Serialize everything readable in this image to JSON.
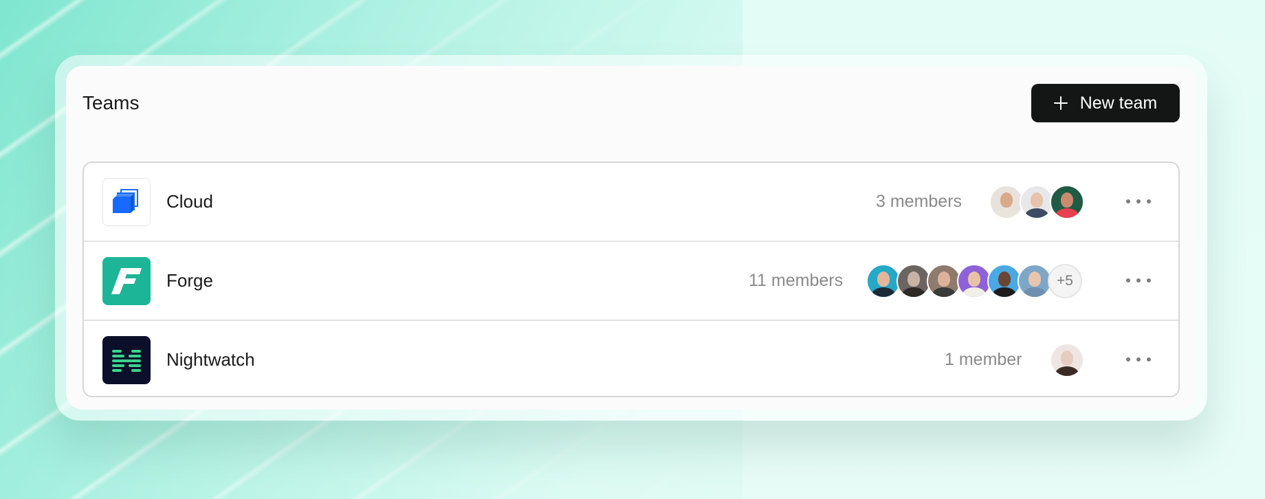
{
  "header": {
    "title": "Teams",
    "new_team_label": "New team"
  },
  "teams": [
    {
      "name": "Cloud",
      "members_label": "3 members",
      "logo": "cloud-logo-icon",
      "avatars": [
        {
          "skin": "#d9a98a",
          "shirt": "#e9e4dc",
          "bg": "#e7e2dc"
        },
        {
          "skin": "#e6c3ad",
          "shirt": "#3d4b63",
          "bg": "#e8e8ea"
        },
        {
          "skin": "#c98b6e",
          "shirt": "#e8404f",
          "bg": "#1f5b45"
        }
      ]
    },
    {
      "name": "Forge",
      "members_label": "11 members",
      "logo": "forge-logo-icon",
      "avatars": [
        {
          "skin": "#e2b79b",
          "shirt": "#1c2a36",
          "bg": "#25a9c6"
        },
        {
          "skin": "#c9b3a4",
          "shirt": "#2f2a28",
          "bg": "#6b6461"
        },
        {
          "skin": "#dcb29a",
          "shirt": "#3a3a3a",
          "bg": "#8f7a6e"
        },
        {
          "skin": "#e7c2a8",
          "shirt": "#f2efe9",
          "bg": "#8e62d9"
        },
        {
          "skin": "#6a4534",
          "shirt": "#1d1d1d",
          "bg": "#4aa8e3"
        },
        {
          "skin": "#e8c5ae",
          "shirt": "#6e8fb0",
          "bg": "#7fa6c6"
        }
      ],
      "overflow_label": "+5"
    },
    {
      "name": "Nightwatch",
      "members_label": "1 member",
      "logo": "nightwatch-logo-icon",
      "avatars": [
        {
          "skin": "#e7cbbd",
          "shirt": "#3b2b25",
          "bg": "#eee6e2"
        }
      ]
    }
  ],
  "colors": {
    "button_bg": "#131614",
    "forge_brand": "#1db597",
    "nightwatch_brand": "#0b0f2a",
    "cloud_brand": "#1769ff"
  }
}
